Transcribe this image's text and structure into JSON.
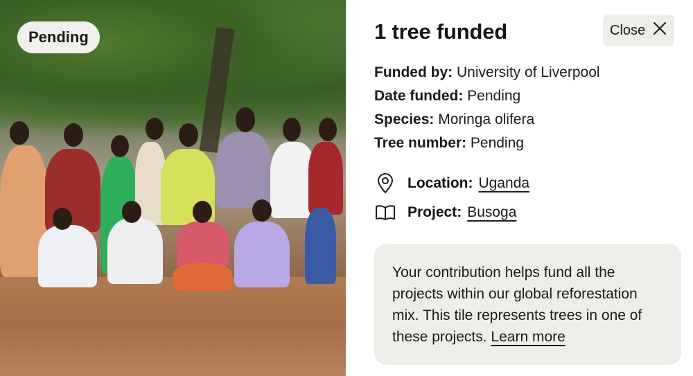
{
  "photo": {
    "alt": "Group photo",
    "badge": "Pending"
  },
  "panel": {
    "title": "1 tree funded",
    "close_label": "Close",
    "details": [
      {
        "key": "Funded by:",
        "value": "University of Liverpool"
      },
      {
        "key": "Date funded:",
        "value": "Pending"
      },
      {
        "key": "Species:",
        "value": "Moringa olifera"
      },
      {
        "key": "Tree number:",
        "value": "Pending"
      }
    ],
    "location": {
      "key": "Location:",
      "value": "Uganda",
      "icon": "map-pin-icon"
    },
    "project": {
      "key": "Project:",
      "value": "Busoga",
      "icon": "book-icon"
    },
    "info": {
      "text": "Your contribution helps fund all the projects within our global reforestation mix. This tile represents trees in one of these projects.",
      "link": "Learn more"
    }
  }
}
